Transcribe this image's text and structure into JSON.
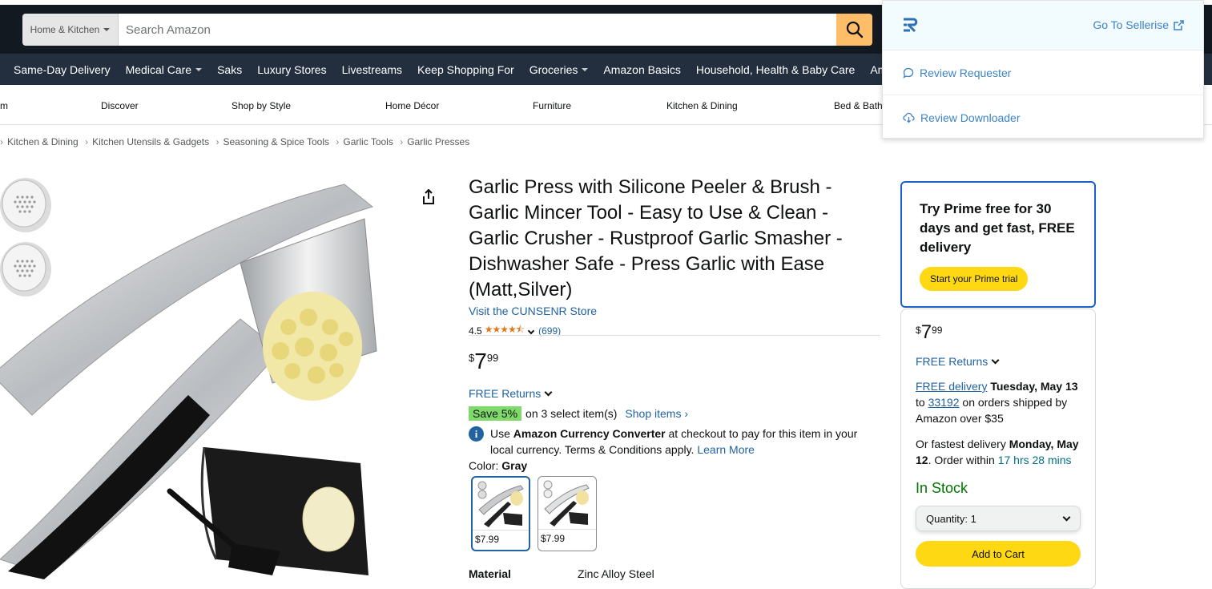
{
  "header": {
    "search_category": "Home & Kitchen",
    "search_placeholder": "Search Amazon"
  },
  "nav_main": [
    {
      "label": "Same-Day Delivery",
      "dropdown": false
    },
    {
      "label": "Medical Care",
      "dropdown": true
    },
    {
      "label": "Saks",
      "dropdown": false
    },
    {
      "label": "Luxury Stores",
      "dropdown": false
    },
    {
      "label": "Livestreams",
      "dropdown": false
    },
    {
      "label": "Keep Shopping For",
      "dropdown": false
    },
    {
      "label": "Groceries",
      "dropdown": true
    },
    {
      "label": "Amazon Basics",
      "dropdown": false
    },
    {
      "label": "Household, Health & Baby Care",
      "dropdown": false
    },
    {
      "label": "Ama",
      "dropdown": false
    }
  ],
  "nav_sub": [
    "m",
    "Discover",
    "Shop by Style",
    "Home Décor",
    "Furniture",
    "Kitchen & Dining",
    "Bed & Bath"
  ],
  "breadcrumb": [
    "Kitchen & Dining",
    "Kitchen Utensils & Gadgets",
    "Seasoning & Spice Tools",
    "Garlic Tools",
    "Garlic Presses"
  ],
  "product": {
    "title": "Garlic Press with Silicone Peeler & Brush - Garlic Mincer Tool - Easy to Use & Clean - Garlic Crusher - Rustproof Garlic Smasher - Dishwasher Safe - Press Garlic with Ease (Matt,Silver)",
    "store": "Visit the CUNSENR Store",
    "rating": "4.5",
    "rating_stars": "★★★★⯪",
    "rating_count": "(699)",
    "price_symbol": "$",
    "price_whole": "7",
    "price_fraction": "99",
    "returns": "FREE Returns",
    "save_badge": "Save 5%",
    "save_text": "on 3 select item(s)",
    "shop_items": "Shop items ›",
    "converter_pre": "Use ",
    "converter_bold": "Amazon Currency Converter",
    "converter_post": " at checkout to pay for this item in your local currency. Terms & Conditions apply. ",
    "learn_more": "Learn More",
    "color_label": "Color: ",
    "color_value": "Gray",
    "swatches": [
      {
        "price": "$7.99",
        "selected": true
      },
      {
        "price": "$7.99",
        "selected": false
      }
    ],
    "spec_label": "Material",
    "spec_value": "Zinc Alloy Steel"
  },
  "sellerise_popup": {
    "go_to": "Go To Sellerise",
    "items": [
      "Review Requester",
      "Review Downloader"
    ]
  },
  "prime": {
    "title": "Try Prime free for 30 days and get fast, FREE delivery",
    "button": "Start your Prime trial"
  },
  "buybox": {
    "price_symbol": "$",
    "price_whole": "7",
    "price_fraction": "99",
    "returns": "FREE Returns",
    "delivery_link": "FREE delivery",
    "delivery_date": "Tuesday, May 13",
    "to": "to",
    "zip": "33192",
    "delivery_rest": "on orders shipped by Amazon over $35",
    "fast_pre": "Or fastest delivery ",
    "fast_date": "Monday, May 12",
    "fast_mid": ". Order within ",
    "fast_time": "17 hrs 28 mins",
    "in_stock": "In Stock",
    "quantity": "Quantity:  1",
    "add_to_cart": "Add to Cart"
  },
  "colors": {
    "header_bg": "#131921",
    "nav_bg": "#232f3e",
    "search_button": "#febd69",
    "link": "#2162a1",
    "prime_border": "#1b5fc9",
    "button_yellow": "#ffd814",
    "in_stock": "#007600",
    "sellerise_accent": "#3d83c6"
  }
}
